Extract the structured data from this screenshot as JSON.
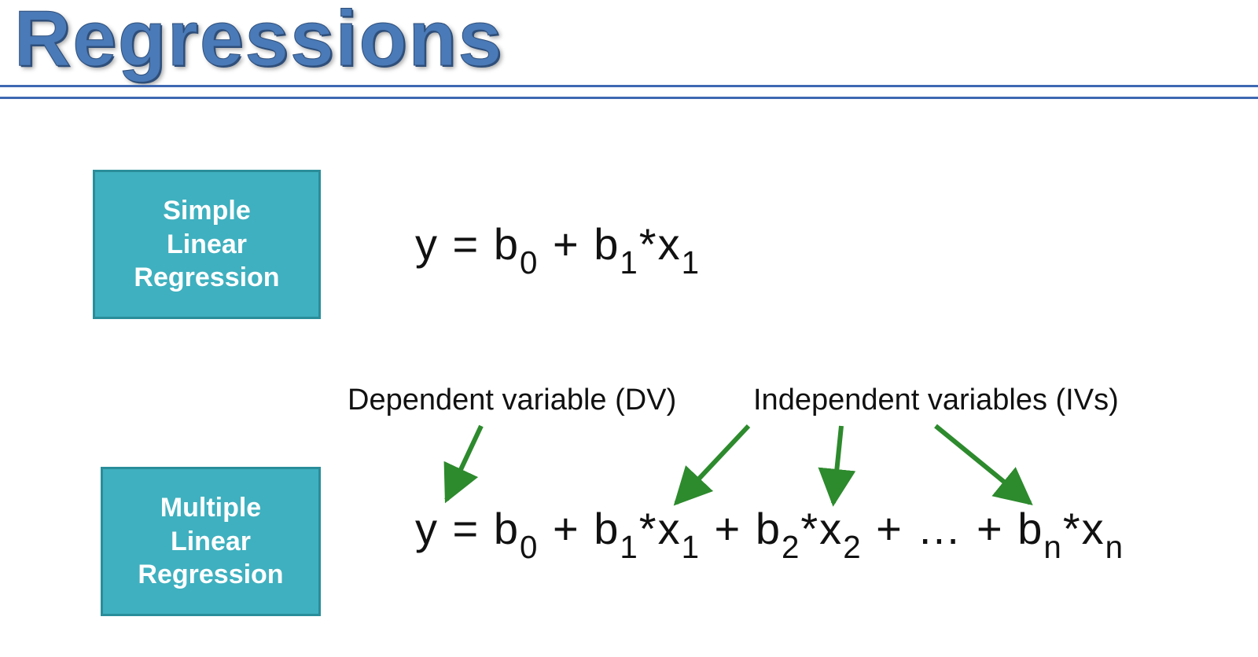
{
  "title": "Regressions",
  "boxes": {
    "simple": {
      "line1": "Simple",
      "line2": "Linear",
      "line3": "Regression"
    },
    "multiple": {
      "line1": "Multiple",
      "line2": "Linear",
      "line3": "Regression"
    }
  },
  "equations": {
    "simple_html": "y = b<sub>0</sub> + b<sub>1</sub>*x<sub>1</sub>",
    "multiple_html": "y = b<sub>0</sub> + b<sub>1</sub>*x<sub>1</sub>  + b<sub>2</sub>*x<sub>2</sub> + … + b<sub>n</sub>*x<sub>n</sub>"
  },
  "annotations": {
    "dv": "Dependent variable (DV)",
    "iv": "Independent variables (IVs)"
  },
  "colors": {
    "title": "#4a7ab7",
    "rule": "#3e68b2",
    "box_fill": "#3fb0bf",
    "box_border": "#2a8d9a",
    "arrow": "#2d8a2d"
  }
}
